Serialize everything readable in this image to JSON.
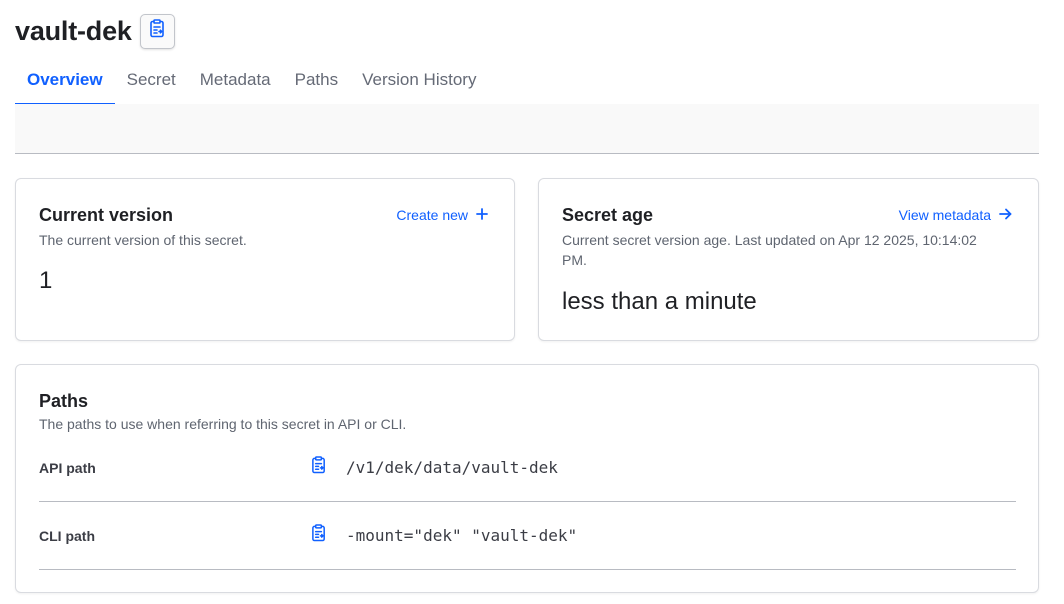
{
  "header": {
    "title": "vault-dek",
    "copy_icon": "clipboard-copy-icon"
  },
  "tabs": [
    {
      "label": "Overview",
      "active": true
    },
    {
      "label": "Secret",
      "active": false
    },
    {
      "label": "Metadata",
      "active": false
    },
    {
      "label": "Paths",
      "active": false
    },
    {
      "label": "Version History",
      "active": false
    }
  ],
  "current_version": {
    "title": "Current version",
    "description": "The current version of this secret.",
    "value": "1",
    "link_label": "Create new",
    "link_icon": "plus-icon"
  },
  "secret_age": {
    "title": "Secret age",
    "description": "Current secret version age. Last updated on Apr 12 2025, 10:14:02 PM.",
    "value": "less than a minute",
    "link_label": "View metadata",
    "link_icon": "arrow-right-icon"
  },
  "paths": {
    "title": "Paths",
    "description": "The paths to use when referring to this secret in API or CLI.",
    "rows": [
      {
        "label": "API path",
        "value": "/v1/dek/data/vault-dek",
        "copy_icon": "clipboard-copy-icon"
      },
      {
        "label": "CLI path",
        "value": "-mount=\"dek\" \"vault-dek\"",
        "copy_icon": "clipboard-copy-icon"
      }
    ]
  },
  "colors": {
    "accent": "#1060ff",
    "text_primary": "#1f2024",
    "text_secondary": "#656a76",
    "border": "#d9dbe0"
  }
}
